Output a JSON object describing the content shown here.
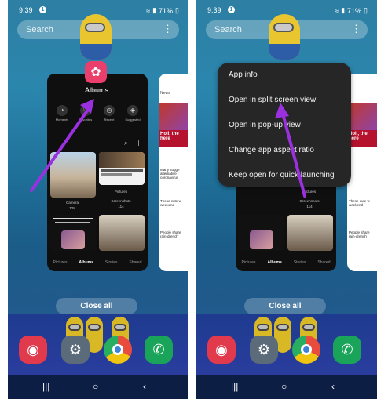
{
  "status": {
    "time": "9:39",
    "battery": "71%"
  },
  "search": {
    "placeholder": "Search"
  },
  "left": {
    "app_label": "Albums",
    "tabs": [
      "Moments",
      "Favorites",
      "Recent",
      "Suggested"
    ],
    "thumbs": [
      {
        "label": "Camera",
        "count": "128"
      },
      {
        "label": "Pictures",
        "count": ""
      },
      {
        "label": "Screenshots",
        "count": "114"
      }
    ],
    "bottom_tabs": [
      "Pictures",
      "Albums",
      "Stories",
      "Shared"
    ],
    "active_tab": "Albums"
  },
  "news": {
    "tab": "News",
    "headline1": "Holi, the here",
    "snippet2": "Many sugge alternative t coronavirus",
    "snippet3": "These cute w weekend",
    "snippet4": "People share rain-drench"
  },
  "menu": {
    "items": [
      "App info",
      "Open in split screen view",
      "Open in pop-up view",
      "Change app aspect ratio",
      "Keep open for quick launching"
    ]
  },
  "close_all": "Close all",
  "colors": {
    "arrow": "#9b30e0",
    "gallery": "#ea3e6c",
    "phone": "#2f6fa0",
    "chrome_green": "#1aa45a"
  }
}
